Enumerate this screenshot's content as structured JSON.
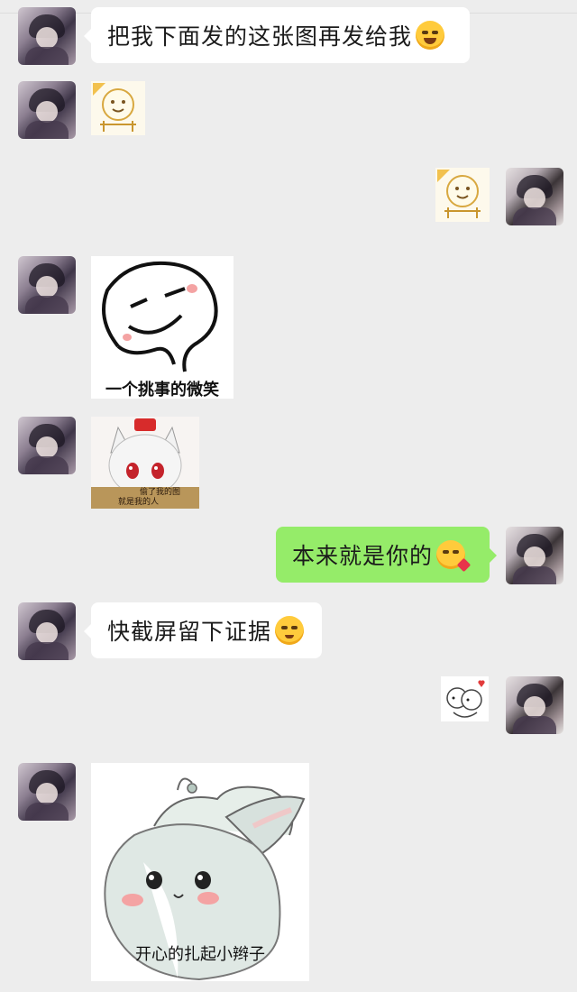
{
  "messages": [
    {
      "side": "left",
      "type": "text",
      "text": "把我下面发的这张图再发给我",
      "emoji": "grinning-sweat-emoji"
    },
    {
      "side": "left",
      "type": "sticker",
      "sticker": "doge-peek-sticker"
    },
    {
      "side": "right",
      "type": "sticker",
      "sticker": "doge-peek-sticker"
    },
    {
      "side": "left",
      "type": "sticker",
      "sticker": "smirk-face-sticker",
      "caption": "一个挑事的微笑"
    },
    {
      "side": "left",
      "type": "sticker",
      "sticker": "anime-wolf-girl-sticker",
      "caption_lines": [
        "偷了我的图",
        "就是我的人"
      ]
    },
    {
      "side": "right",
      "type": "text",
      "text": "本来就是你的",
      "emoji": "kissing-heart-emoji"
    },
    {
      "side": "left",
      "type": "text",
      "text": "快截屏留下证据",
      "emoji": "flushed-emoji"
    },
    {
      "side": "right",
      "type": "sticker",
      "sticker": "hug-heart-sticker"
    },
    {
      "side": "left",
      "type": "sticker",
      "sticker": "bunny-ponytail-sticker",
      "caption": "开心的扎起小辫子"
    }
  ],
  "colors": {
    "background": "#ededed",
    "bubble_left": "#ffffff",
    "bubble_right": "#95ec69",
    "blush": "#f4a3a3"
  }
}
